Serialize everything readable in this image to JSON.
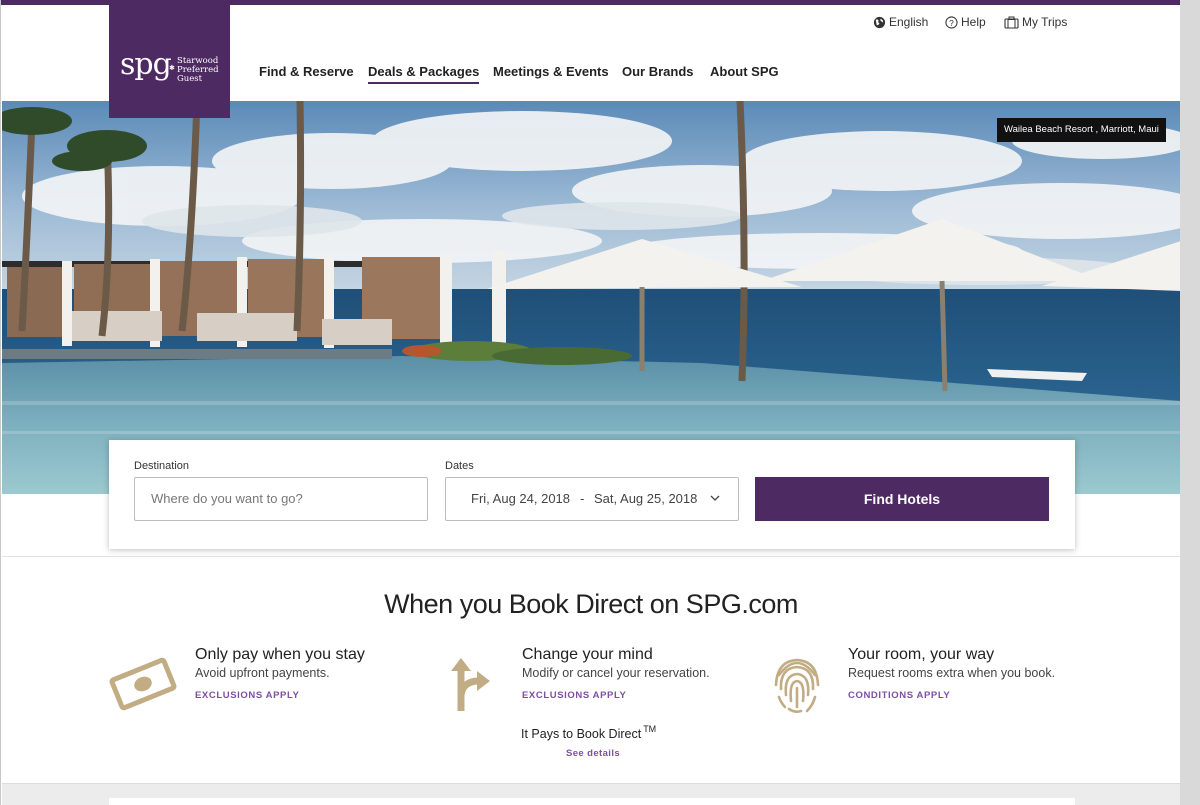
{
  "brand": {
    "logo_text": "spg",
    "logo_subtitle_lines": [
      "Starwood",
      "Preferred",
      "Guest"
    ],
    "primary_color": "#4e2a63",
    "link_color": "#7f4fa3"
  },
  "utility_nav": [
    {
      "label": "English",
      "icon": "globe-icon"
    },
    {
      "label": "Help",
      "icon": "help-circle-icon"
    },
    {
      "label": "My Trips",
      "icon": "suitcase-icon"
    }
  ],
  "main_nav": [
    {
      "label": "Find & Reserve",
      "active": false
    },
    {
      "label": "Deals & Packages",
      "active": true
    },
    {
      "label": "Meetings & Events",
      "active": false
    },
    {
      "label": "Our Brands",
      "active": false
    },
    {
      "label": "About SPG",
      "active": false
    }
  ],
  "hero": {
    "credit": "Wailea Beach Resort , Marriott, Maui"
  },
  "search": {
    "destination_label": "Destination",
    "destination_placeholder": "Where do you want to go?",
    "dates_label": "Dates",
    "date_from": "Fri, Aug 24, 2018",
    "date_separator": "-",
    "date_to": "Sat, Aug 25, 2018",
    "submit_label": "Find Hotels"
  },
  "book_direct": {
    "title": "When you Book Direct on SPG.com",
    "benefits": [
      {
        "icon": "money-icon",
        "title": "Only pay when you stay",
        "description": "Avoid upfront payments.",
        "link": "EXCLUSIONS APPLY"
      },
      {
        "icon": "direction-arrows-icon",
        "title": "Change your mind",
        "description": "Modify or cancel your reservation.",
        "link": "EXCLUSIONS APPLY"
      },
      {
        "icon": "fingerprint-icon",
        "title": "Your room, your way",
        "description": "Request rooms extra when you book.",
        "link": "CONDITIONS APPLY"
      }
    ],
    "tagline": "It Pays to Book Direct",
    "tagline_mark": "TM",
    "details_link": "See details"
  }
}
